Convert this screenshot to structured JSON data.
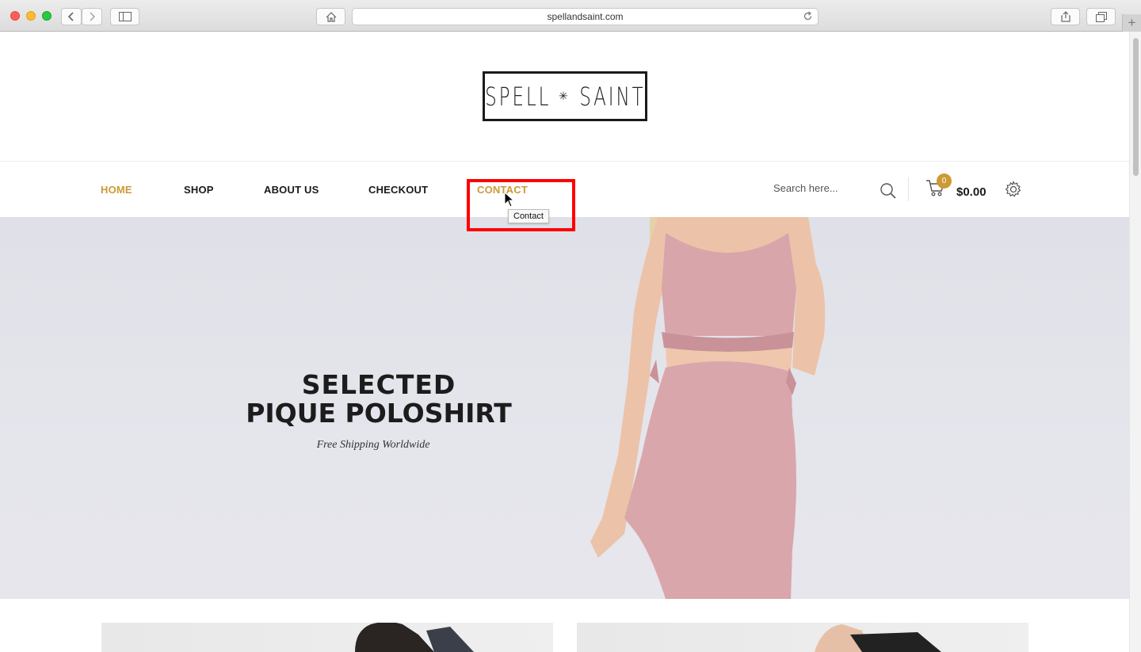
{
  "browser": {
    "url": "spellandsaint.com"
  },
  "site": {
    "logo_left": "SPELL",
    "logo_sep": "✳",
    "logo_right": "SAINT"
  },
  "nav": {
    "items": [
      {
        "label": "HOME",
        "active": true
      },
      {
        "label": "SHOP",
        "active": false
      },
      {
        "label": "ABOUT US",
        "active": false
      },
      {
        "label": "CHECKOUT",
        "active": false
      },
      {
        "label": "CONTACT",
        "active": true
      }
    ],
    "search_placeholder": "Search here...",
    "cart_count": "0",
    "cart_total": "$0.00",
    "tooltip": "Contact"
  },
  "hero": {
    "title_line1": "SELECTED",
    "title_line2": "PIQUE POLOSHIRT",
    "subtitle": "Free Shipping Worldwide"
  },
  "colors": {
    "accent": "#cc9a34",
    "highlight": "#ff0000",
    "dress": "#d9a6ab"
  }
}
